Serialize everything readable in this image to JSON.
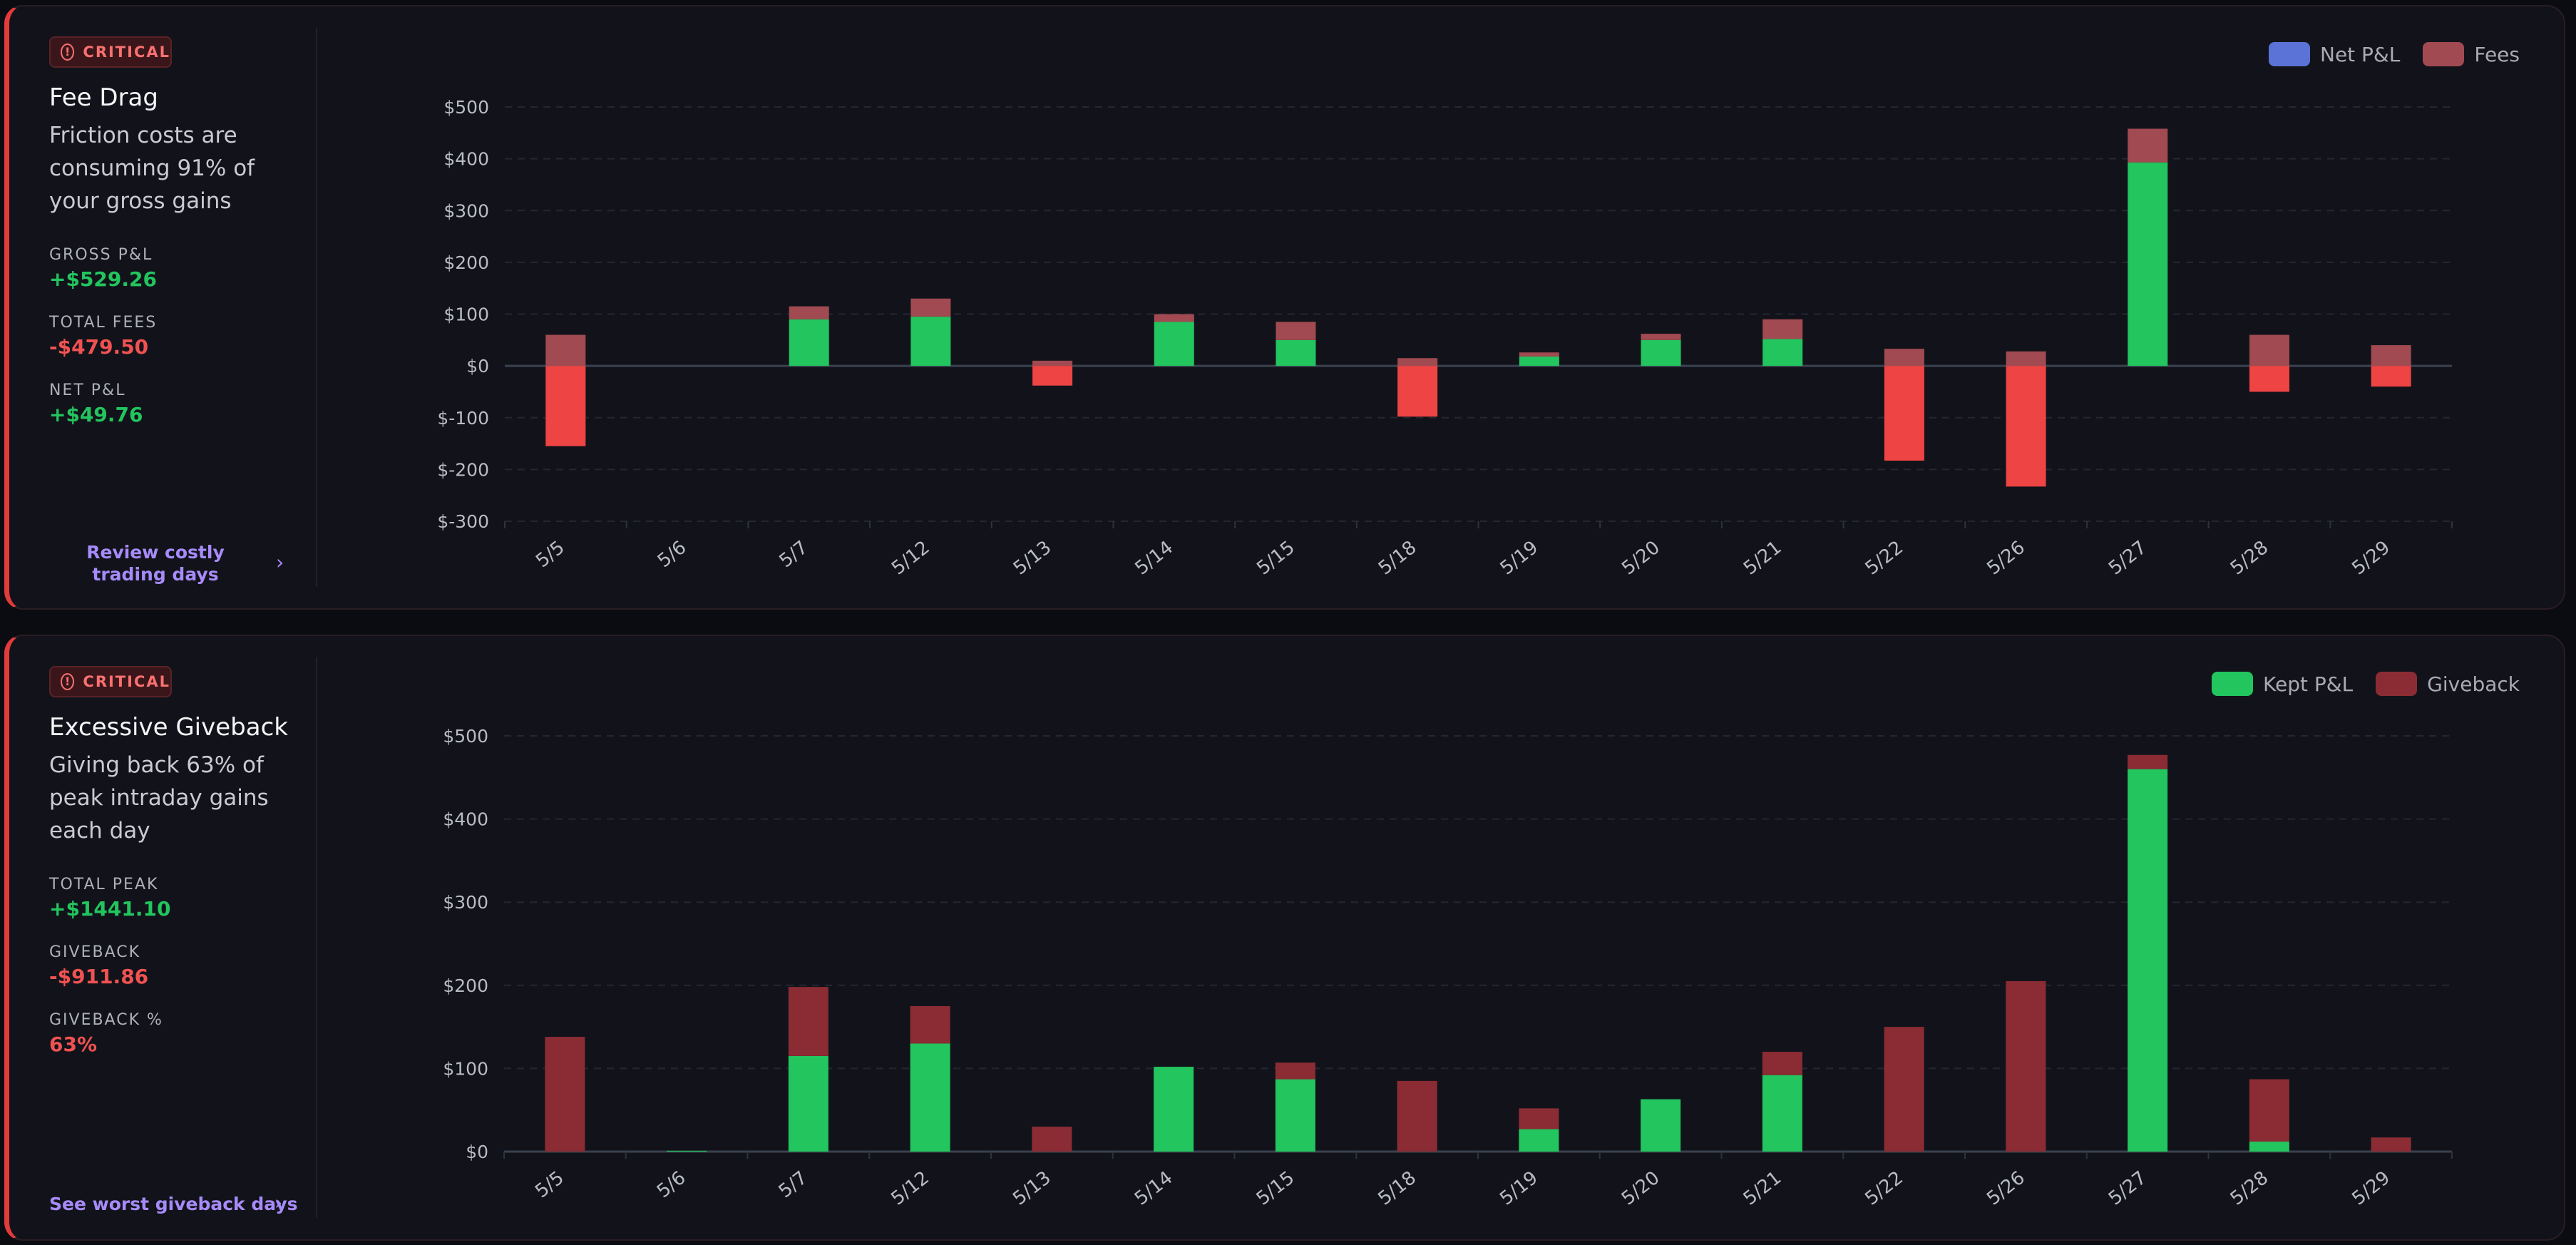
{
  "cards": [
    {
      "badge": "CRITICAL",
      "title": "Fee Drag",
      "description": "Friction costs are consuming 91% of your gross gains",
      "stats": [
        {
          "label": "GROSS P&L",
          "value": "+$529.26",
          "tone": "green"
        },
        {
          "label": "TOTAL FEES",
          "value": "-$479.50",
          "tone": "red"
        },
        {
          "label": "NET P&L",
          "value": "+$49.76",
          "tone": "green"
        }
      ],
      "link": "Review costly trading days",
      "legend": [
        {
          "label": "Net P&L",
          "color": "#5b73d6"
        },
        {
          "label": "Fees",
          "color": "#a14a51"
        }
      ]
    },
    {
      "badge": "CRITICAL",
      "title": "Excessive Giveback",
      "description": "Giving back 63% of peak intraday gains each day",
      "stats": [
        {
          "label": "TOTAL PEAK",
          "value": "+$1441.10",
          "tone": "green"
        },
        {
          "label": "GIVEBACK",
          "value": "-$911.86",
          "tone": "red"
        },
        {
          "label": "GIVEBACK %",
          "value": "63%",
          "tone": "red"
        }
      ],
      "link": "See worst giveback days",
      "legend": [
        {
          "label": "Kept P&L",
          "color": "#22c55e"
        },
        {
          "label": "Giveback",
          "color": "#8b2c34"
        }
      ]
    }
  ],
  "colors": {
    "positive": "#22c55e",
    "negative": "#ef4444",
    "fees": "#a14a51",
    "giveback": "#8b2c34"
  },
  "chart_data": [
    {
      "type": "bar",
      "stacked": true,
      "categories": [
        "5/5",
        "5/6",
        "5/7",
        "5/12",
        "5/13",
        "5/14",
        "5/15",
        "5/18",
        "5/19",
        "5/20",
        "5/21",
        "5/22",
        "5/26",
        "5/27",
        "5/28",
        "5/29"
      ],
      "series": [
        {
          "name": "Net P&L",
          "values": [
            -155,
            0,
            90,
            95,
            -38,
            85,
            50,
            -98,
            18,
            50,
            52,
            -183,
            -233,
            393,
            -50,
            -40
          ]
        },
        {
          "name": "Fees",
          "values": [
            60,
            0,
            25,
            35,
            10,
            15,
            35,
            15,
            8,
            12,
            38,
            33,
            28,
            65,
            60,
            40
          ]
        }
      ],
      "yticks": [
        "$500",
        "$400",
        "$300",
        "$200",
        "$100",
        "$0",
        "$-100",
        "$-200",
        "$-300"
      ],
      "ylim": [
        -300,
        500
      ],
      "grid": true,
      "legend_position": "top-right"
    },
    {
      "type": "bar",
      "stacked": true,
      "categories": [
        "5/5",
        "5/6",
        "5/7",
        "5/12",
        "5/13",
        "5/14",
        "5/15",
        "5/18",
        "5/19",
        "5/20",
        "5/21",
        "5/22",
        "5/26",
        "5/27",
        "5/28",
        "5/29"
      ],
      "series": [
        {
          "name": "Kept P&L",
          "values": [
            0,
            1,
            115,
            130,
            0,
            102,
            87,
            0,
            27,
            63,
            92,
            0,
            0,
            460,
            12,
            0
          ]
        },
        {
          "name": "Giveback",
          "values": [
            138,
            0,
            83,
            45,
            30,
            0,
            20,
            85,
            25,
            0,
            28,
            150,
            205,
            17,
            75,
            17
          ]
        }
      ],
      "yticks": [
        "$500",
        "$400",
        "$300",
        "$200",
        "$100",
        "$0"
      ],
      "ylim": [
        0,
        500
      ],
      "grid": true,
      "legend_position": "top-right"
    }
  ]
}
